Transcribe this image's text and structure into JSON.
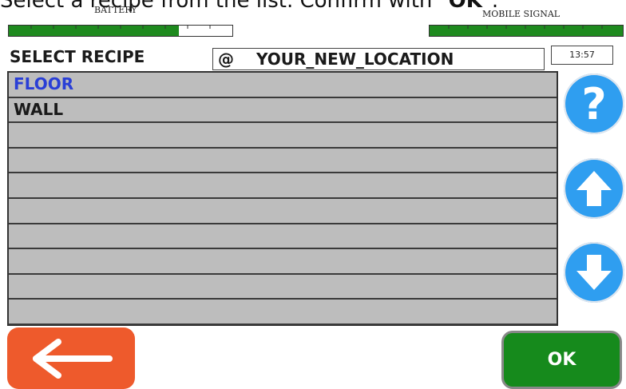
{
  "instruction": {
    "prefix": "Select a recipe from the list. Confirm with \"",
    "emphasis": "OK",
    "suffix": "\"."
  },
  "battery": {
    "label": "BATTERY",
    "level_percent": 76
  },
  "signal": {
    "label": "MOBILE SIGNAL",
    "level_percent": 100
  },
  "header": {
    "title": "SELECT RECIPE",
    "location_prefix": "@",
    "location": "YOUR_NEW_LOCATION",
    "time": "13:57"
  },
  "recipes": {
    "items": [
      {
        "label": "FLOOR",
        "selected": true
      },
      {
        "label": "WALL",
        "selected": false
      },
      {
        "label": "",
        "selected": false
      },
      {
        "label": "",
        "selected": false
      },
      {
        "label": "",
        "selected": false
      },
      {
        "label": "",
        "selected": false
      },
      {
        "label": "",
        "selected": false
      },
      {
        "label": "",
        "selected": false
      },
      {
        "label": "",
        "selected": false
      },
      {
        "label": "",
        "selected": false
      }
    ]
  },
  "buttons": {
    "help_glyph": "?",
    "help_icon": "question-icon",
    "up_icon": "arrow-up-icon",
    "down_icon": "arrow-down-icon",
    "back_icon": "arrow-left-icon",
    "ok_label": "OK"
  },
  "colors": {
    "accent_blue": "#2f9ef0",
    "selected_text": "#2a3fd6",
    "ok_green": "#168a1c",
    "back_orange": "#ee5a2c",
    "gauge_green": "#1e8a1e",
    "list_gray": "#bdbdbd"
  }
}
